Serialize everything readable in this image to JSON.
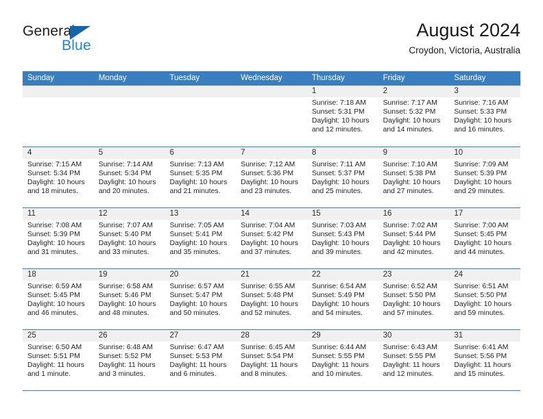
{
  "brand": {
    "name_part1": "General",
    "name_part2": "Blue",
    "logo_icon": "triangle-flag-icon"
  },
  "header": {
    "title": "August 2024",
    "subtitle": "Croydon, Victoria, Australia"
  },
  "colors": {
    "header_blue": "#3a7ebf",
    "brand_blue": "#2585d4",
    "logo_blue": "#1565a8",
    "daynum_strip": "#f0f0f0",
    "cell_bg": "#ffffff"
  },
  "calendar": {
    "weekday_headers": [
      "Sunday",
      "Monday",
      "Tuesday",
      "Wednesday",
      "Thursday",
      "Friday",
      "Saturday"
    ],
    "weeks": [
      [
        {
          "day": "",
          "empty": true
        },
        {
          "day": "",
          "empty": true
        },
        {
          "day": "",
          "empty": true
        },
        {
          "day": "",
          "empty": true
        },
        {
          "day": "1",
          "sunrise": "Sunrise: 7:18 AM",
          "sunset": "Sunset: 5:31 PM",
          "daylight1": "Daylight: 10 hours",
          "daylight2": "and 12 minutes."
        },
        {
          "day": "2",
          "sunrise": "Sunrise: 7:17 AM",
          "sunset": "Sunset: 5:32 PM",
          "daylight1": "Daylight: 10 hours",
          "daylight2": "and 14 minutes."
        },
        {
          "day": "3",
          "sunrise": "Sunrise: 7:16 AM",
          "sunset": "Sunset: 5:33 PM",
          "daylight1": "Daylight: 10 hours",
          "daylight2": "and 16 minutes."
        }
      ],
      [
        {
          "day": "4",
          "sunrise": "Sunrise: 7:15 AM",
          "sunset": "Sunset: 5:34 PM",
          "daylight1": "Daylight: 10 hours",
          "daylight2": "and 18 minutes."
        },
        {
          "day": "5",
          "sunrise": "Sunrise: 7:14 AM",
          "sunset": "Sunset: 5:34 PM",
          "daylight1": "Daylight: 10 hours",
          "daylight2": "and 20 minutes."
        },
        {
          "day": "6",
          "sunrise": "Sunrise: 7:13 AM",
          "sunset": "Sunset: 5:35 PM",
          "daylight1": "Daylight: 10 hours",
          "daylight2": "and 21 minutes."
        },
        {
          "day": "7",
          "sunrise": "Sunrise: 7:12 AM",
          "sunset": "Sunset: 5:36 PM",
          "daylight1": "Daylight: 10 hours",
          "daylight2": "and 23 minutes."
        },
        {
          "day": "8",
          "sunrise": "Sunrise: 7:11 AM",
          "sunset": "Sunset: 5:37 PM",
          "daylight1": "Daylight: 10 hours",
          "daylight2": "and 25 minutes."
        },
        {
          "day": "9",
          "sunrise": "Sunrise: 7:10 AM",
          "sunset": "Sunset: 5:38 PM",
          "daylight1": "Daylight: 10 hours",
          "daylight2": "and 27 minutes."
        },
        {
          "day": "10",
          "sunrise": "Sunrise: 7:09 AM",
          "sunset": "Sunset: 5:39 PM",
          "daylight1": "Daylight: 10 hours",
          "daylight2": "and 29 minutes."
        }
      ],
      [
        {
          "day": "11",
          "sunrise": "Sunrise: 7:08 AM",
          "sunset": "Sunset: 5:39 PM",
          "daylight1": "Daylight: 10 hours",
          "daylight2": "and 31 minutes."
        },
        {
          "day": "12",
          "sunrise": "Sunrise: 7:07 AM",
          "sunset": "Sunset: 5:40 PM",
          "daylight1": "Daylight: 10 hours",
          "daylight2": "and 33 minutes."
        },
        {
          "day": "13",
          "sunrise": "Sunrise: 7:05 AM",
          "sunset": "Sunset: 5:41 PM",
          "daylight1": "Daylight: 10 hours",
          "daylight2": "and 35 minutes."
        },
        {
          "day": "14",
          "sunrise": "Sunrise: 7:04 AM",
          "sunset": "Sunset: 5:42 PM",
          "daylight1": "Daylight: 10 hours",
          "daylight2": "and 37 minutes."
        },
        {
          "day": "15",
          "sunrise": "Sunrise: 7:03 AM",
          "sunset": "Sunset: 5:43 PM",
          "daylight1": "Daylight: 10 hours",
          "daylight2": "and 39 minutes."
        },
        {
          "day": "16",
          "sunrise": "Sunrise: 7:02 AM",
          "sunset": "Sunset: 5:44 PM",
          "daylight1": "Daylight: 10 hours",
          "daylight2": "and 42 minutes."
        },
        {
          "day": "17",
          "sunrise": "Sunrise: 7:00 AM",
          "sunset": "Sunset: 5:45 PM",
          "daylight1": "Daylight: 10 hours",
          "daylight2": "and 44 minutes."
        }
      ],
      [
        {
          "day": "18",
          "sunrise": "Sunrise: 6:59 AM",
          "sunset": "Sunset: 5:45 PM",
          "daylight1": "Daylight: 10 hours",
          "daylight2": "and 46 minutes."
        },
        {
          "day": "19",
          "sunrise": "Sunrise: 6:58 AM",
          "sunset": "Sunset: 5:46 PM",
          "daylight1": "Daylight: 10 hours",
          "daylight2": "and 48 minutes."
        },
        {
          "day": "20",
          "sunrise": "Sunrise: 6:57 AM",
          "sunset": "Sunset: 5:47 PM",
          "daylight1": "Daylight: 10 hours",
          "daylight2": "and 50 minutes."
        },
        {
          "day": "21",
          "sunrise": "Sunrise: 6:55 AM",
          "sunset": "Sunset: 5:48 PM",
          "daylight1": "Daylight: 10 hours",
          "daylight2": "and 52 minutes."
        },
        {
          "day": "22",
          "sunrise": "Sunrise: 6:54 AM",
          "sunset": "Sunset: 5:49 PM",
          "daylight1": "Daylight: 10 hours",
          "daylight2": "and 54 minutes."
        },
        {
          "day": "23",
          "sunrise": "Sunrise: 6:52 AM",
          "sunset": "Sunset: 5:50 PM",
          "daylight1": "Daylight: 10 hours",
          "daylight2": "and 57 minutes."
        },
        {
          "day": "24",
          "sunrise": "Sunrise: 6:51 AM",
          "sunset": "Sunset: 5:50 PM",
          "daylight1": "Daylight: 10 hours",
          "daylight2": "and 59 minutes."
        }
      ],
      [
        {
          "day": "25",
          "sunrise": "Sunrise: 6:50 AM",
          "sunset": "Sunset: 5:51 PM",
          "daylight1": "Daylight: 11 hours",
          "daylight2": "and 1 minute."
        },
        {
          "day": "26",
          "sunrise": "Sunrise: 6:48 AM",
          "sunset": "Sunset: 5:52 PM",
          "daylight1": "Daylight: 11 hours",
          "daylight2": "and 3 minutes."
        },
        {
          "day": "27",
          "sunrise": "Sunrise: 6:47 AM",
          "sunset": "Sunset: 5:53 PM",
          "daylight1": "Daylight: 11 hours",
          "daylight2": "and 6 minutes."
        },
        {
          "day": "28",
          "sunrise": "Sunrise: 6:45 AM",
          "sunset": "Sunset: 5:54 PM",
          "daylight1": "Daylight: 11 hours",
          "daylight2": "and 8 minutes."
        },
        {
          "day": "29",
          "sunrise": "Sunrise: 6:44 AM",
          "sunset": "Sunset: 5:55 PM",
          "daylight1": "Daylight: 11 hours",
          "daylight2": "and 10 minutes."
        },
        {
          "day": "30",
          "sunrise": "Sunrise: 6:43 AM",
          "sunset": "Sunset: 5:55 PM",
          "daylight1": "Daylight: 11 hours",
          "daylight2": "and 12 minutes."
        },
        {
          "day": "31",
          "sunrise": "Sunrise: 6:41 AM",
          "sunset": "Sunset: 5:56 PM",
          "daylight1": "Daylight: 11 hours",
          "daylight2": "and 15 minutes."
        }
      ]
    ]
  }
}
